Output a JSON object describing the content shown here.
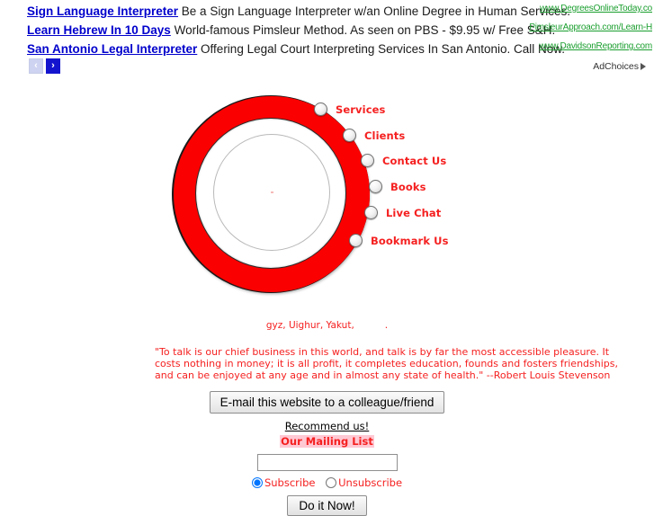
{
  "ads": {
    "items": [
      {
        "title": "Sign Language Interpreter",
        "description": "Be a Sign Language Interpreter w/an Online Degree in Human Services.",
        "url": "www.DegreesOnlineToday.co"
      },
      {
        "title": "Learn Hebrew In 10 Days",
        "description": "World-famous Pimsleur Method. As seen on PBS - $9.95 w/ Free S&H.",
        "url": "PimsleurApproach.com/Learn-H"
      },
      {
        "title": "San Antonio Legal Interpreter",
        "description": "Offering Legal Court Interpreting Services In San Antonio. Call Now.",
        "url": "www.DavidsonReporting.com"
      }
    ],
    "prev_arrow": "‹",
    "next_arrow": "›",
    "adchoices_label": "AdChoices",
    "link_color": "#0000cc",
    "url_color": "#1a9e2e"
  },
  "circle_menu": {
    "ring_color": "#fb0000",
    "label_color": "#f52020",
    "items": [
      {
        "label": "Services"
      },
      {
        "label": "Clients"
      },
      {
        "label": "Contact Us"
      },
      {
        "label": "Books"
      },
      {
        "label": "Live Chat"
      },
      {
        "label": "Bookmark Us"
      }
    ]
  },
  "languages_line": {
    "text": "gyz, Uighur, Yakut,",
    "trailing": "."
  },
  "quote": {
    "line1": "\"To talk is our chief business in this world, and talk is by far the most accessible pleasure. It",
    "line2": "costs nothing in money; it is all profit, it completes education, founds and fosters friendships,",
    "line3": "and can be enjoyed at any age and in almost any state of health.\" --Robert Louis Stevenson",
    "color": "#f52020"
  },
  "form": {
    "email_friend_button": "E-mail this website to a colleague/friend",
    "recommend_link": "Recommend us!",
    "mailing_list_title": "Our Mailing List",
    "email_input_value": "",
    "email_input_placeholder": "",
    "subscribe_label": "Subscribe",
    "unsubscribe_label": "Unsubscribe",
    "selected_option": "Subscribe",
    "submit_button": "Do it Now!",
    "highlight_color": "#ffc9d4"
  }
}
